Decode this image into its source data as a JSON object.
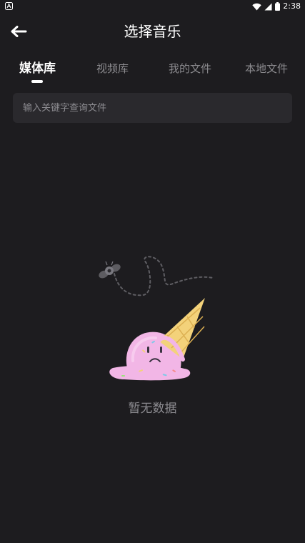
{
  "status_bar": {
    "time": "2:38",
    "app_icon": "app-notification-icon",
    "wifi_icon": "wifi-icon",
    "signal_icon": "signal-icon",
    "battery_icon": "battery-icon"
  },
  "header": {
    "title": "选择音乐",
    "back_icon": "arrow-left-icon"
  },
  "tabs": [
    {
      "label": "媒体库",
      "active": true
    },
    {
      "label": "视频库",
      "active": false
    },
    {
      "label": "我的文件",
      "active": false
    },
    {
      "label": "本地文件",
      "active": false
    }
  ],
  "search": {
    "placeholder": "输入关键字查询文件",
    "value": ""
  },
  "empty_state": {
    "illustration": "melted-ice-cream-icon",
    "text": "暂无数据"
  },
  "colors": {
    "background": "#1d1c1f",
    "search_background": "#2a292d",
    "inactive_tab": "#8b8a8e",
    "placeholder": "#8c8b90",
    "ice_cream_pink": "#f2b6e6",
    "cone_yellow": "#f3d27a"
  }
}
